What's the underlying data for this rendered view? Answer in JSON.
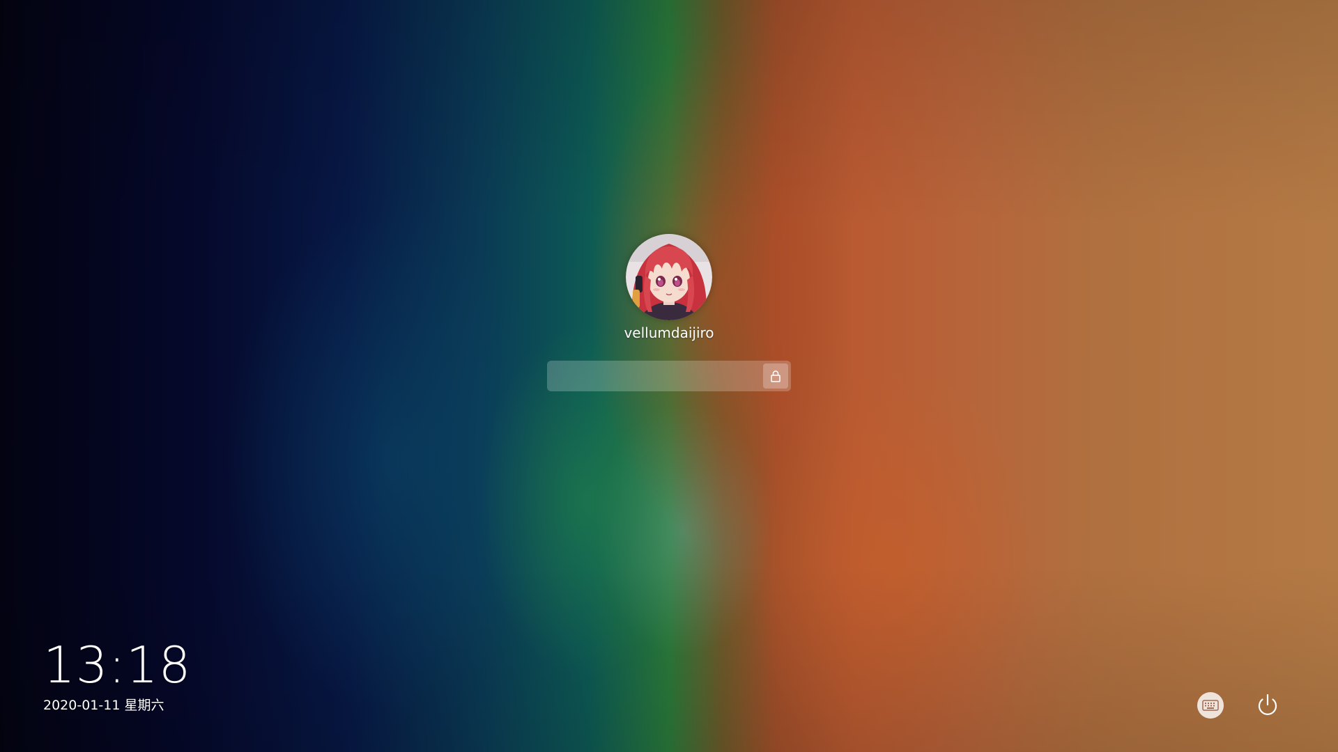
{
  "user": {
    "name": "vellumdaijiro",
    "avatar_icon": "anime-avatar-icon"
  },
  "password": {
    "value": "",
    "placeholder": "",
    "submit_icon": "lock-icon"
  },
  "clock": {
    "time": "13:18",
    "date": "2020-01-11 星期六"
  },
  "controls": {
    "keyboard_icon": "keyboard-icon",
    "power_icon": "power-icon"
  },
  "colors": {
    "text": "#ffffff",
    "avatar_hair": "#d8474f",
    "avatar_skin": "#f6dccf"
  }
}
